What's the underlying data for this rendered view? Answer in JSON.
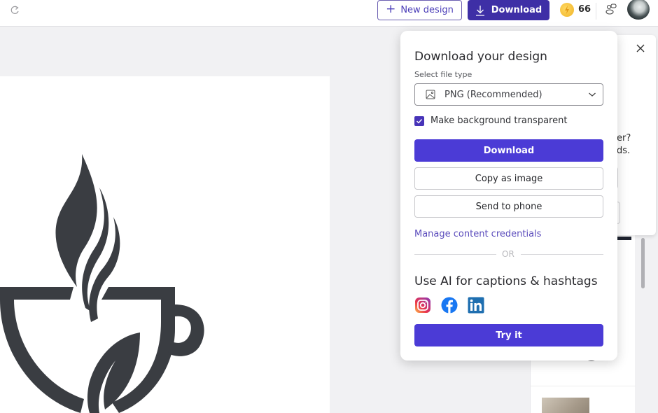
{
  "topbar": {
    "redo_icon": "redo-icon",
    "new_design_label": "New design",
    "download_label": "Download",
    "credits": "66",
    "credit_icon": "lightning-coin-icon",
    "shapes_icon": "shapes-icon",
    "avatar_icon": "user-avatar"
  },
  "download_panel": {
    "title": "Download your design",
    "file_type_label": "Select file type",
    "file_type_value": "PNG (Recommended)",
    "transparent_label": "Make background transparent",
    "transparent_checked": true,
    "download_button": "Download",
    "copy_button": "Copy as image",
    "send_button": "Send to phone",
    "credentials_link": "Manage content credentials",
    "or_label": "OR",
    "ai_title": "Use AI for captions & hashtags",
    "social_icons": [
      "instagram-icon",
      "facebook-icon",
      "linkedin-icon"
    ],
    "try_button": "Try it"
  },
  "background_popup": {
    "partial_text": "er?\nds.",
    "close_icon": "close-icon"
  },
  "colors": {
    "brand_primary": "#4b3bd6",
    "brand_dark": "#3e2fa6",
    "link": "#5b4cbc"
  }
}
